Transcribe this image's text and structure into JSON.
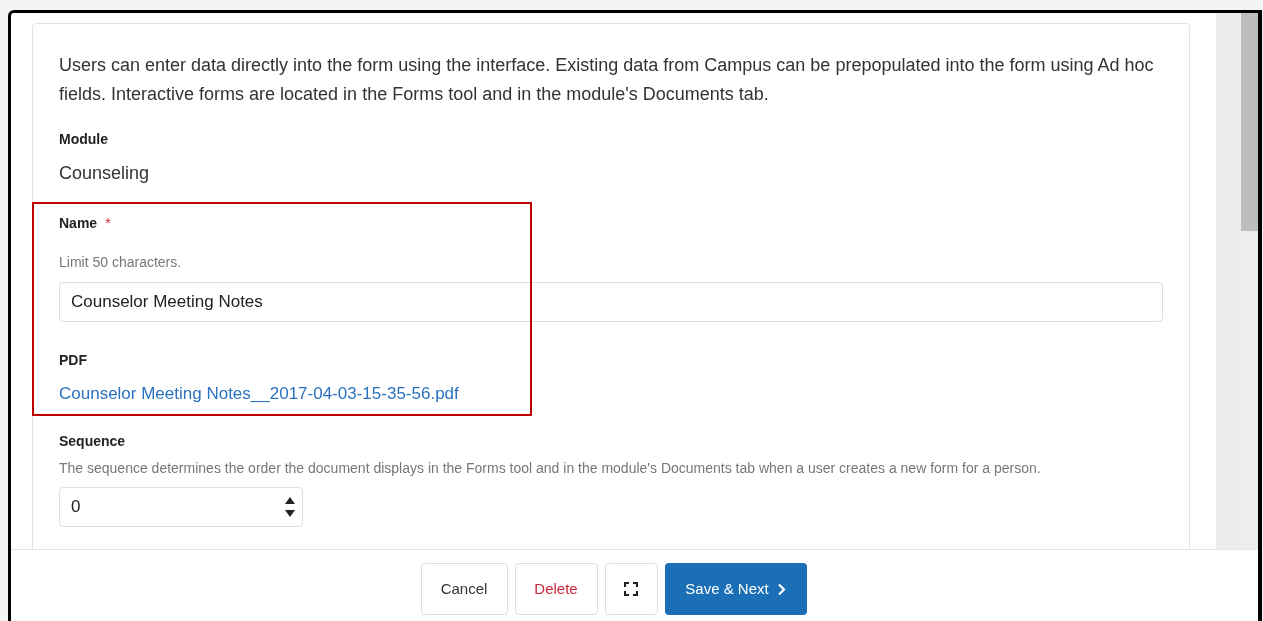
{
  "description": "Users can enter data directly into the form using the interface. Existing data from Campus can be prepopulated into the form using Ad hoc fields. Interactive forms are located in the Forms tool and in the module's Documents tab.",
  "module": {
    "label": "Module",
    "value": "Counseling"
  },
  "name_field": {
    "label": "Name",
    "required_mark": "*",
    "hint": "Limit 50 characters.",
    "value": "Counselor Meeting Notes"
  },
  "pdf": {
    "label": "PDF",
    "link": "Counselor Meeting Notes__2017-04-03-15-35-56.pdf"
  },
  "sequence": {
    "label": "Sequence",
    "hint": "The sequence determines the order the document displays in the Forms tool and in the module's Documents tab when a user creates a new form for a person.",
    "value": "0"
  },
  "buttons": [
    {
      "kind": "cancel",
      "label": "Cancel"
    },
    {
      "kind": "delete",
      "label": "Delete"
    },
    {
      "kind": "expand"
    },
    {
      "kind": "save",
      "label": "Save & Next"
    }
  ]
}
